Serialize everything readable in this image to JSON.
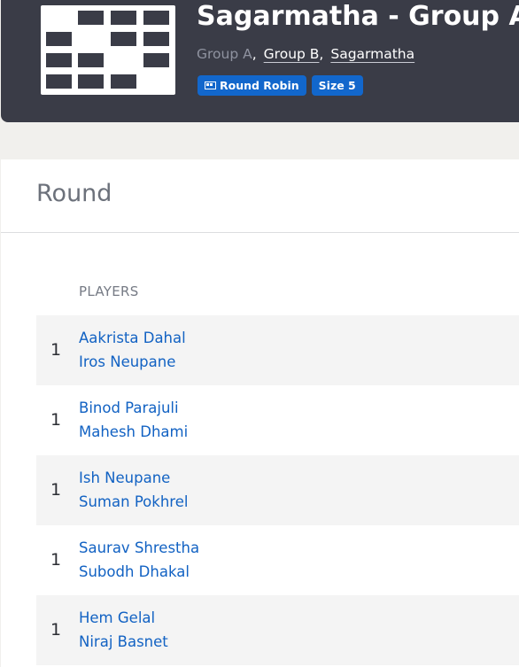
{
  "header": {
    "title": "Sagarmatha - Group A",
    "breadcrumb": {
      "current": "Group A",
      "links": [
        "Group B",
        "Sagarmatha"
      ],
      "separator": ","
    },
    "badges": {
      "format": "Round Robin",
      "format_icon": "grid-icon",
      "size": "Size 5"
    },
    "logo_icon": "round-robin-grid-logo"
  },
  "card": {
    "title": "Round",
    "column_header": "PLAYERS",
    "rows": [
      {
        "round": "1",
        "player1": "Aakrista Dahal",
        "player2": "Iros Neupane"
      },
      {
        "round": "1",
        "player1": "Binod Parajuli",
        "player2": "Mahesh Dhami"
      },
      {
        "round": "1",
        "player1": "Ish Neupane",
        "player2": "Suman Pokhrel"
      },
      {
        "round": "1",
        "player1": "Saurav Shrestha",
        "player2": "Subodh Dhakal"
      },
      {
        "round": "1",
        "player1": "Hem Gelal",
        "player2": "Niraj Basnet"
      }
    ]
  },
  "colors": {
    "header_bg": "#3a3c47",
    "accent": "#1267cc",
    "link": "#1262c3",
    "page_bg": "#f1f0ed"
  }
}
